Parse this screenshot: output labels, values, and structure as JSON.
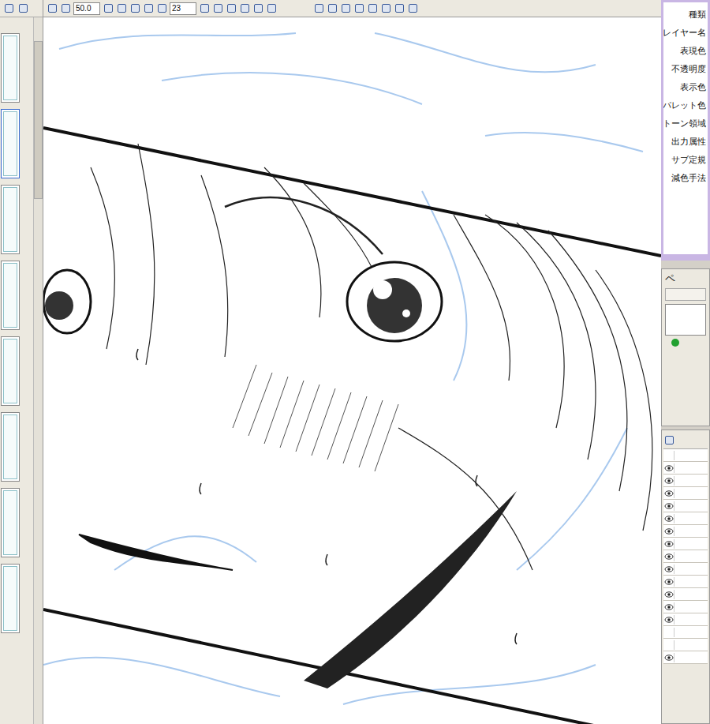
{
  "window": {
    "title": ""
  },
  "toolbar": {
    "zoom": "50.0",
    "brush_size": "23"
  },
  "pages": [
    {
      "selected": false
    },
    {
      "selected": true
    },
    {
      "selected": false
    },
    {
      "selected": false
    },
    {
      "selected": false
    },
    {
      "selected": false
    },
    {
      "selected": false
    },
    {
      "selected": false
    }
  ],
  "properties": {
    "labels": [
      "種類",
      "レイヤー名",
      "表現色",
      "不透明度",
      "表示色",
      "パレット色",
      "トーン領域",
      "出力属性",
      "サブ定規",
      "減色手法"
    ]
  },
  "pen_panel": {
    "title": "ペ"
  },
  "layers": [
    {
      "visible": false
    },
    {
      "visible": true
    },
    {
      "visible": true
    },
    {
      "visible": true
    },
    {
      "visible": true
    },
    {
      "visible": true
    },
    {
      "visible": true
    },
    {
      "visible": true
    },
    {
      "visible": true
    },
    {
      "visible": true
    },
    {
      "visible": true
    },
    {
      "visible": true
    },
    {
      "visible": true
    },
    {
      "visible": true
    },
    {
      "visible": false
    },
    {
      "visible": false
    },
    {
      "visible": true
    }
  ]
}
